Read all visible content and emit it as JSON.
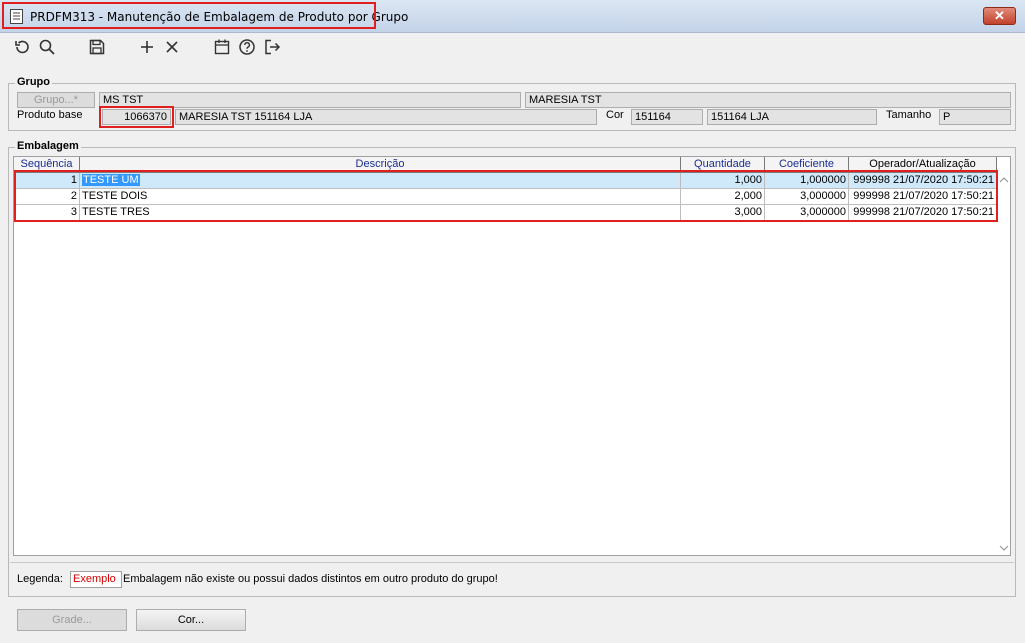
{
  "window": {
    "title": "PRDFM313 - Manutenção de Embalagem de Produto por Grupo",
    "close_glyph": "✕"
  },
  "toolbar": {
    "icons": [
      "undo-icon",
      "search-icon",
      "save-icon",
      "add-icon",
      "delete-icon",
      "calendar-icon",
      "help-icon",
      "exit-icon"
    ]
  },
  "grupo": {
    "section_label": "Grupo",
    "grupo_button": "Grupo...*",
    "grupo_code": "MS TST",
    "grupo_name": "MARESIA TST",
    "produto_base_label": "Produto base",
    "produto_base_value": "1066370",
    "produto_desc": "MARESIA TST 151164 LJA",
    "cor_label": "Cor",
    "cor_code": "151164",
    "cor_desc": "151164 LJA",
    "tamanho_label": "Tamanho",
    "tamanho_value": "P"
  },
  "embalagem": {
    "section_label": "Embalagem",
    "columns": [
      "Sequência",
      "Descrição",
      "Quantidade",
      "Coeficiente",
      "Operador/Atualização"
    ],
    "rows": [
      {
        "seq": "1",
        "desc": "TESTE UM",
        "qtd": "1,000",
        "coef": "1,000000",
        "op": "999998 21/07/2020 17:50:21"
      },
      {
        "seq": "2",
        "desc": "TESTE DOIS",
        "qtd": "2,000",
        "coef": "3,000000",
        "op": "999998 21/07/2020 17:50:21"
      },
      {
        "seq": "3",
        "desc": "TESTE TRES",
        "qtd": "3,000",
        "coef": "3,000000",
        "op": "999998 21/07/2020 17:50:21"
      }
    ]
  },
  "legenda": {
    "label": "Legenda:",
    "example": "Exemplo",
    "text": "Embalagem não existe ou possui dados distintos em outro produto do grupo!"
  },
  "buttons": {
    "grade": "Grade...",
    "cor": "Cor..."
  },
  "colors": {
    "highlight": "#e01f1f",
    "header_text": "#1a2d8f",
    "selection": "#3399ff"
  }
}
